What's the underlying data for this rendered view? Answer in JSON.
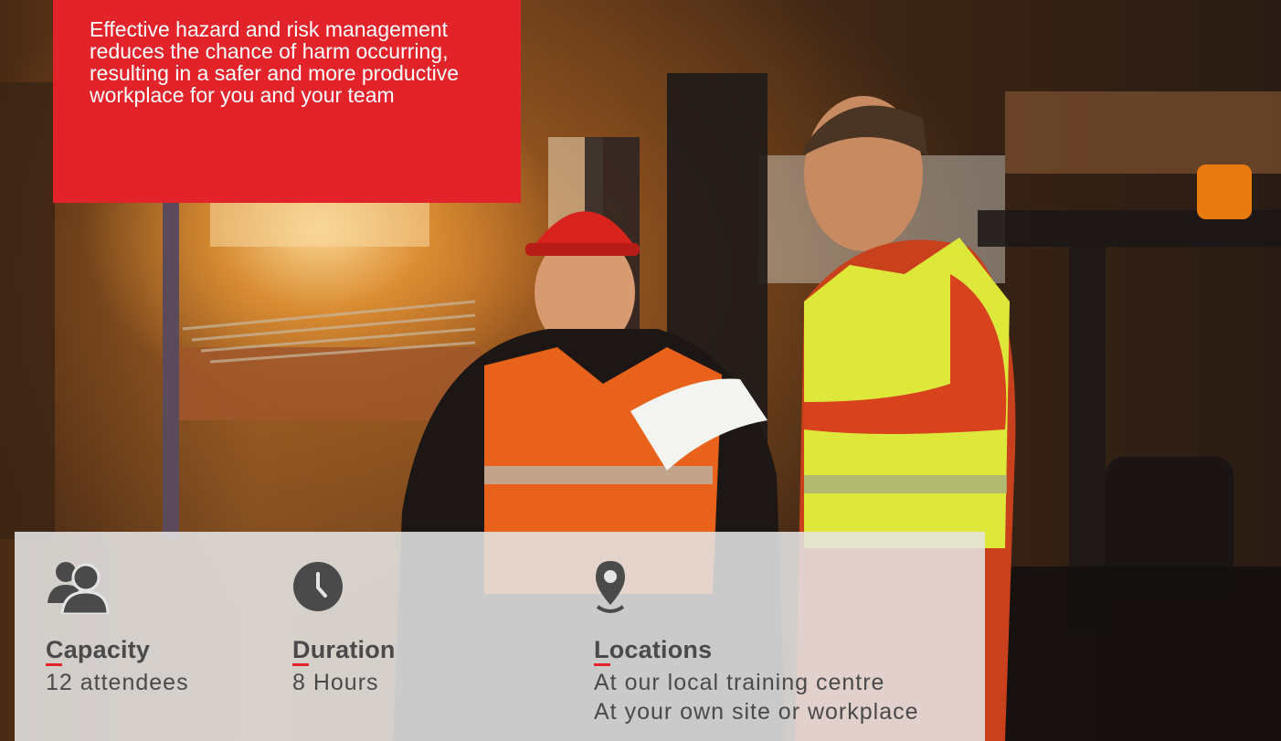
{
  "hero": {
    "image": "warehouse-workers-photo",
    "quote": "Effective hazard and risk management reduces the chance of harm occurring, resulting in a safer and more productive workplace for you and your team"
  },
  "colors": {
    "accent": "#e2232a",
    "panel": "#e4e4e4",
    "text": "#4a4a4a"
  },
  "info": {
    "capacity": {
      "icon": "people-icon",
      "label": "Capacity",
      "value": "12 attendees"
    },
    "duration": {
      "icon": "clock-icon",
      "label": "Duration",
      "value": "8 Hours"
    },
    "locations": {
      "icon": "location-pin-icon",
      "label": "Locations",
      "values": [
        "At our local training centre",
        "At your own site or workplace"
      ]
    }
  }
}
